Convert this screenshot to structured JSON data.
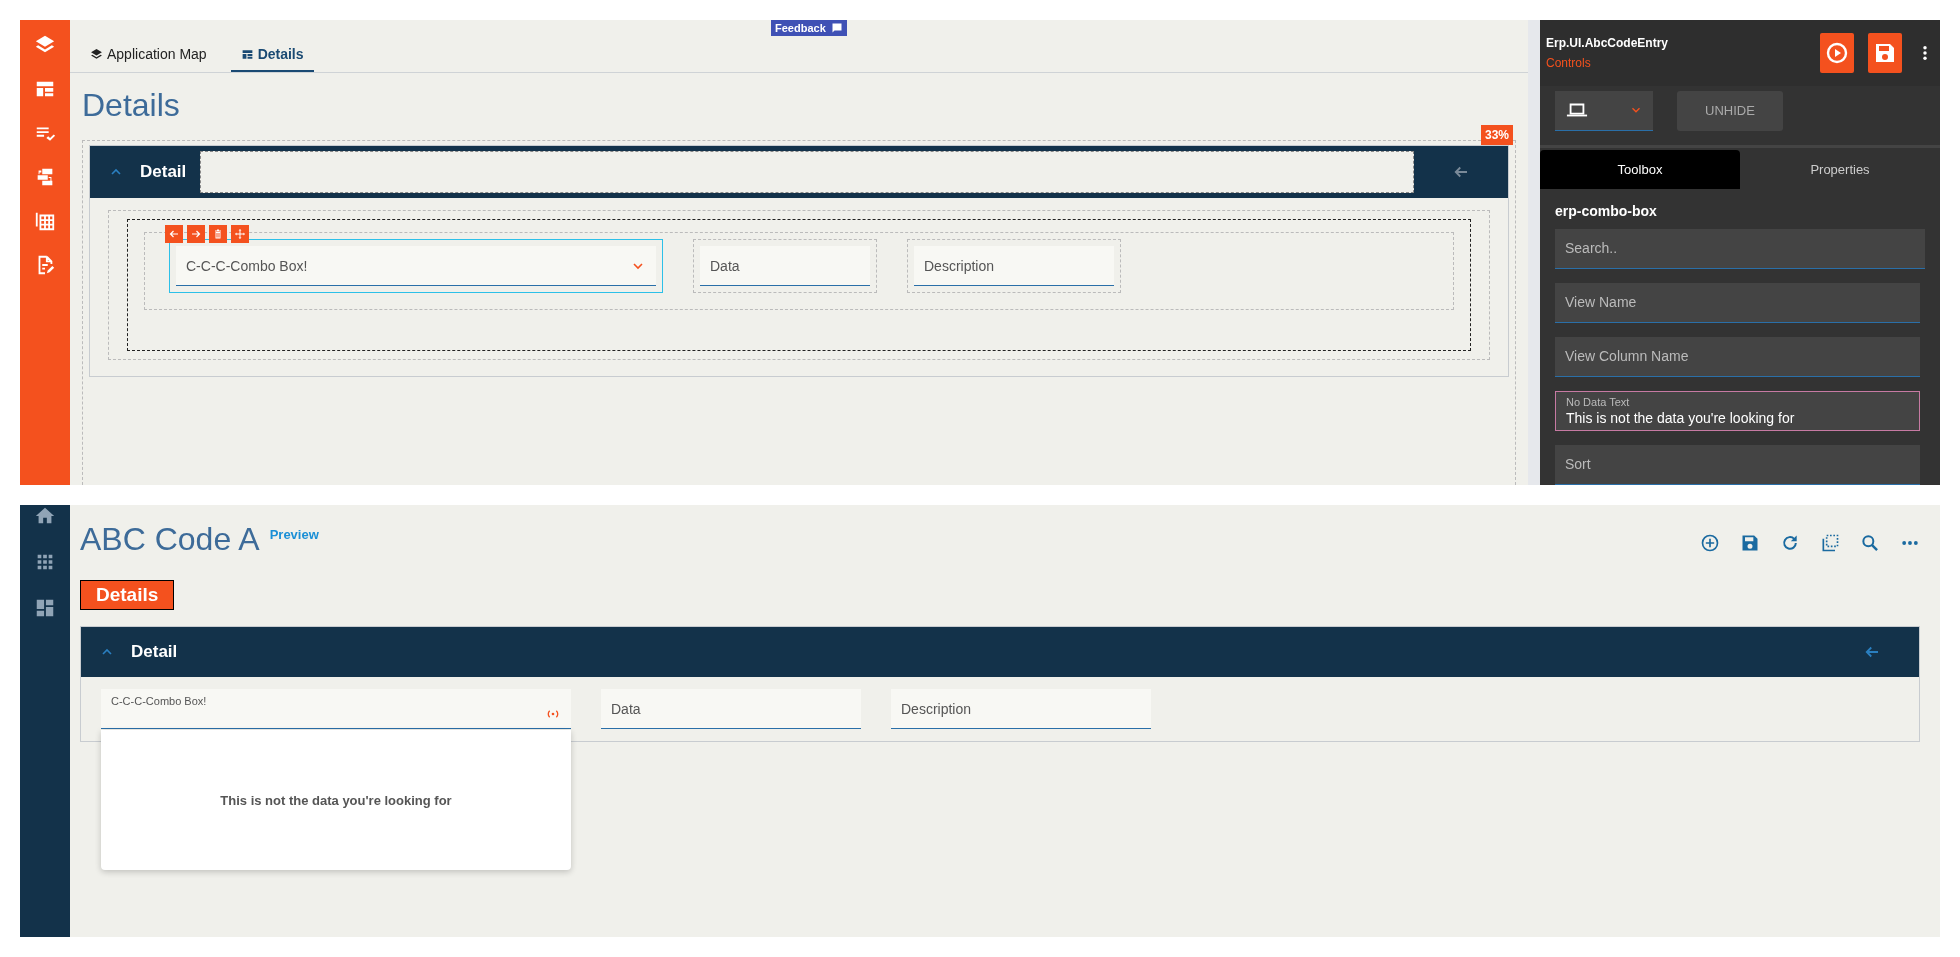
{
  "designer": {
    "tabs": [
      {
        "label": "Application Map",
        "kind": "map",
        "selected": false
      },
      {
        "label": "Details",
        "kind": "layout",
        "selected": true
      }
    ],
    "feedback_button": "Feedback",
    "page_title": "Details",
    "completion_badge": "33%",
    "panel": {
      "title": "Detail",
      "expanded": true
    },
    "fields": [
      {
        "label": "C-C-C-Combo Box!",
        "kind": "combo",
        "selected": true
      },
      {
        "label": "Data",
        "kind": "text",
        "selected": false
      },
      {
        "label": "Description",
        "kind": "text",
        "selected": false
      }
    ]
  },
  "inspector": {
    "app_name": "Erp.UI.AbcCodeEntry",
    "subtitle": "Controls",
    "unhide_button": "UNHIDE",
    "tabs": [
      {
        "label": "Toolbox",
        "selected": true
      },
      {
        "label": "Properties",
        "selected": false
      }
    ],
    "component_name": "erp-combo-box",
    "search": {
      "placeholder": "Search.."
    },
    "properties": [
      {
        "label": "View Name",
        "focused": false
      },
      {
        "label": "View Column Name",
        "focused": false
      },
      {
        "label": "No Data Text",
        "value": "This is not the data you're looking for",
        "focused": true
      },
      {
        "label": "Sort",
        "focused": false
      }
    ]
  },
  "preview": {
    "title": "ABC Code A",
    "badge": "Preview",
    "section_button": "Details",
    "panel": {
      "title": "Detail",
      "expanded": true
    },
    "fields": [
      {
        "label": "C-C-C-Combo Box!",
        "kind": "combo",
        "open": true
      },
      {
        "label": "Data",
        "kind": "text",
        "open": false
      },
      {
        "label": "Description",
        "kind": "text",
        "open": false
      }
    ],
    "dropdown_message": "This is not the data you're looking for"
  }
}
